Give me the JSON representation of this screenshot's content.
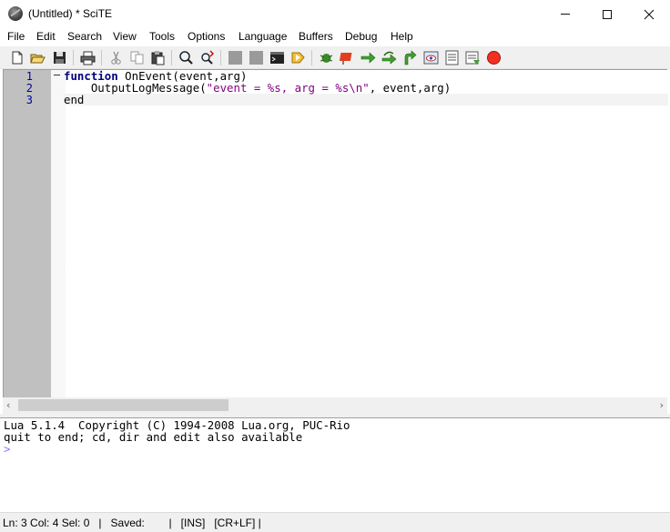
{
  "window": {
    "title": "(Untitled) * SciTE",
    "icon": "scite-app-icon"
  },
  "menu": [
    "File",
    "Edit",
    "Search",
    "View",
    "Tools",
    "Options",
    "Language",
    "Buffers",
    "Debug",
    "Help"
  ],
  "toolbar": {
    "buttons": [
      "new-icon",
      "open-icon",
      "save-icon",
      "print-icon",
      "cut-icon",
      "copy-icon",
      "paste-icon",
      "find-icon",
      "replace-icon",
      "compile-icon",
      "build-icon",
      "terminal-icon",
      "go-icon",
      "debug-bug-icon",
      "breakpoint-icon",
      "step-icon",
      "step-over-icon",
      "step-out-icon",
      "watch-icon",
      "locals-icon",
      "stack-icon",
      "stop-icon"
    ]
  },
  "editor": {
    "line_numbers": [
      "1",
      "2",
      "3"
    ],
    "lines": [
      {
        "kw": "function",
        "rest": " OnEvent(event,arg)"
      },
      {
        "pre": "    OutputLogMessage(",
        "str": "\"event = %s, arg = %s\\n\"",
        "post": ", event,arg)"
      },
      {
        "plain": "end"
      }
    ]
  },
  "output": {
    "lines": [
      "Lua 5.1.4  Copyright (C) 1994-2008 Lua.org, PUC-Rio",
      "quit to end; cd, dir and edit also available"
    ],
    "prompt": ">"
  },
  "statusbar": {
    "text": "Ln: 3 Col: 4 Sel: 0   |   Saved:        |   [INS]   [CR+LF] |"
  },
  "colors": {
    "keyword": "#00007f",
    "string": "#7f007f",
    "line_number": "#0000a0",
    "gutter": "#c0c0c0",
    "prompt": "#7f7fff"
  }
}
